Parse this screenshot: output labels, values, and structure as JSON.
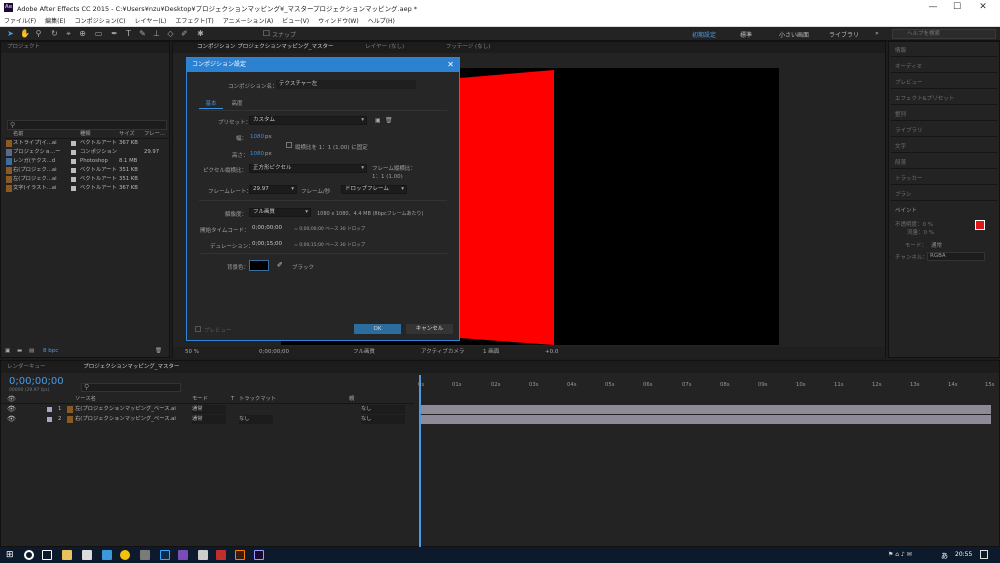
{
  "window": {
    "logo": "Ae",
    "title": "Adobe After Effects CC 2015 - C:¥Users¥nzu¥Desktop¥プロジェクションマッピング¥_マスタープロジェクションマッピング.aep *",
    "min": "—",
    "max": "☐",
    "close": "✕"
  },
  "menu": [
    "ファイル(F)",
    "編集(E)",
    "コンポジション(C)",
    "レイヤー(L)",
    "エフェクト(T)",
    "アニメーション(A)",
    "ビュー(V)",
    "ウィンドウ(W)",
    "ヘルプ(H)"
  ],
  "toolbar": {
    "snap": "スナップ",
    "workspaces": [
      "初期設定",
      "標準",
      "小さい画面",
      "ライブラリ"
    ],
    "more": "»",
    "search_placeholder": "ヘルプを検索"
  },
  "project": {
    "tab": "プロジェクト",
    "columns": [
      "名前",
      "種類",
      "サイズ",
      "フレー..."
    ],
    "items": [
      {
        "name": "ストライプ(イ...ai",
        "type": "ベクトルアート",
        "size": "367 KB",
        "frame": ""
      },
      {
        "name": "プロジェクショ...ー",
        "type": "コンポジション",
        "size": "",
        "frame": "29.97"
      },
      {
        "name": "レンガ(テクス...d",
        "type": "Photoshop",
        "size": "8.1 MB",
        "frame": ""
      },
      {
        "name": "右(プロジェク...ai",
        "type": "ベクトルアート",
        "size": "351 KB",
        "frame": ""
      },
      {
        "name": "左(プロジェク...ai",
        "type": "ベクトルアート",
        "size": "351 KB",
        "frame": ""
      },
      {
        "name": "文字(イラスト...ai",
        "type": "ベクトルアート",
        "size": "367 KB",
        "frame": ""
      }
    ],
    "bpc": "8 bpc"
  },
  "viewer": {
    "tabs": [
      "コンポジション プロジェクションマッピング_マスター",
      "レイヤー (なし)",
      "フッテージ (なし)"
    ],
    "zoom": "50 %",
    "time": "0;00;00;00",
    "resolution": "フル画質",
    "camera": "アクティブカメラ",
    "views": "1 画面",
    "exposure": "+0.0"
  },
  "right_panel": [
    "情報",
    "オーディオ",
    "プレビュー",
    "エフェクト&プリセット",
    "整列",
    "ライブラリ",
    "文字",
    "段落",
    "トラッカー",
    "ブラシ",
    "ペイント"
  ],
  "paint": {
    "opacity": "不透明度：0 %",
    "flow": "流量：0 %",
    "mode_label": "モード：",
    "mode": "通常",
    "channel_label": "チャンネル：",
    "channel": "RGBA",
    "fg_color": "#e0161b"
  },
  "dialog": {
    "title": "コンポジション設定",
    "name_label": "コンポジション名：",
    "name_value": "テクスチャー左",
    "tabs": [
      "基本",
      "高度"
    ],
    "preset_label": "プリセット：",
    "preset": "カスタム",
    "width_label": "幅：",
    "width": "1080",
    "height_label": "高さ：",
    "height": "1080",
    "px": "px",
    "lock_label": "縦横比を 1：1 (1.00) に固定",
    "par_label": "ピクセル縦横比：",
    "par": "正方形ピクセル",
    "frame_aspect_label": "フレーム縦横比：",
    "frame_aspect": "1：1 (1.00)",
    "fps_label": "フレームレート：",
    "fps": "29.97",
    "fps_unit": "フレーム/秒",
    "drop": "ドロップフレーム",
    "res_label": "解像度：",
    "res": "フル画質",
    "res_info": "1080 x 1080、4.4 MB (8bpcフレームあたり)",
    "start_label": "開始タイムコード：",
    "start": "0;00;00;00",
    "start_info": "= 0;00;00;00 ベース 30 ドロップ",
    "dur_label": "デュレーション：",
    "dur": "0;00;15;00",
    "dur_info": "= 0;00;15;00 ベース 30 ドロップ",
    "bg_label": "背景色：",
    "bg_name": "ブラック",
    "preview": "プレビュー",
    "ok": "OK",
    "cancel": "キャンセル"
  },
  "timeline": {
    "tabs": [
      "レンダーキュー",
      "プロジェクションマッピング_マスター"
    ],
    "time": "0;00;00;00",
    "fps_info": "00000 (29.97 fps)",
    "col_source": "ソース名",
    "col_mode": "モード",
    "col_t": "T",
    "col_trkmat": "トラックマット",
    "col_parent": "親",
    "layers": [
      {
        "num": "1",
        "name": "左(プロジェクションマッピング_ベース.ai",
        "mode": "通常",
        "trk": "",
        "parent": "なし"
      },
      {
        "num": "2",
        "name": "右(プロジェクションマッピング_ベース.ai",
        "mode": "通常",
        "trk": "なし",
        "parent": "なし"
      }
    ],
    "ruler": [
      "0s",
      "01s",
      "02s",
      "03s",
      "04s",
      "05s",
      "06s",
      "07s",
      "08s",
      "09s",
      "10s",
      "11s",
      "12s",
      "13s",
      "14s",
      "15s"
    ]
  },
  "taskbar": {
    "clock": "20:55",
    "ime": "あ"
  }
}
